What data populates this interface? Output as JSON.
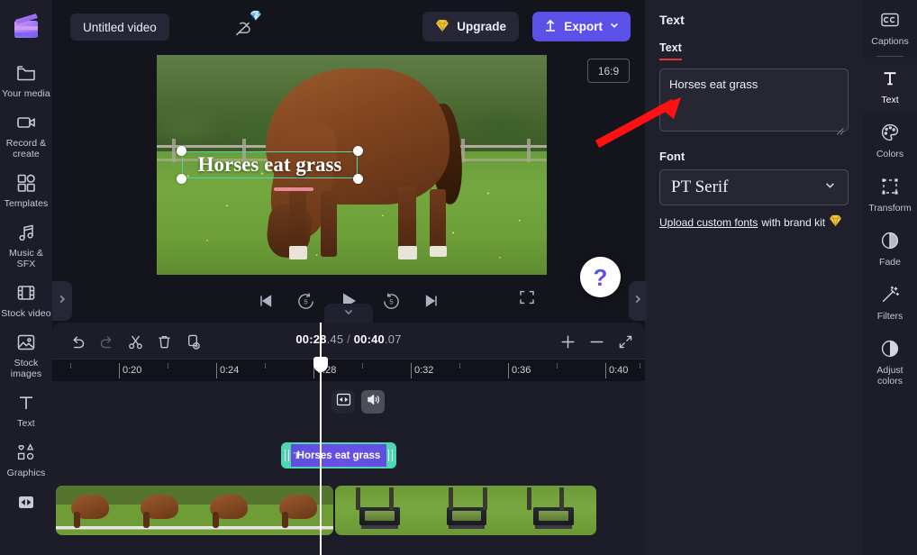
{
  "app": {
    "logo_icon": "clapperboard-logo",
    "window_title": "Untitled video"
  },
  "left_sidebar": {
    "items": [
      {
        "label": "Your media",
        "icon": "folder-icon"
      },
      {
        "label": "Record & create",
        "icon": "video-camera-icon"
      },
      {
        "label": "Templates",
        "icon": "templates-grid-icon"
      },
      {
        "label": "Music & SFX",
        "icon": "music-note-icon"
      },
      {
        "label": "Stock video",
        "icon": "film-strip-icon"
      },
      {
        "label": "Stock images",
        "icon": "image-icon"
      },
      {
        "label": "Text",
        "icon": "text-t-icon"
      },
      {
        "label": "Graphics",
        "icon": "shapes-icon"
      },
      {
        "label": "",
        "icon": "transitions-icon"
      }
    ],
    "collapse_icon": "chevron-right-icon"
  },
  "topbar": {
    "project_title": "Untitled video",
    "cloud_status_icon": "cloud-off-icon",
    "cloud_gem_icon": "gem-icon",
    "upgrade_label": "Upgrade",
    "upgrade_icon": "gem-icon",
    "export_label": "Export",
    "export_icon": "upload-arrow-icon",
    "export_chevron_icon": "chevron-down-icon",
    "export_color": "#5b51e8"
  },
  "preview": {
    "aspect_ratio": "16:9",
    "overlay_text": "Horses eat grass",
    "selection_color": "#4fd6b0",
    "underline_color": "#e98b92",
    "controls": [
      {
        "name": "skip-to-start",
        "icon": "skip-back-icon"
      },
      {
        "name": "rewind-5-seconds",
        "icon": "rewind-5-icon"
      },
      {
        "name": "play",
        "icon": "play-icon"
      },
      {
        "name": "forward-5-seconds",
        "icon": "forward-5-icon"
      },
      {
        "name": "skip-to-end",
        "icon": "skip-forward-icon"
      }
    ],
    "fullscreen_icon": "fullscreen-icon",
    "help_glyph": "?",
    "collapse_icon": "chevron-down-icon"
  },
  "timeline": {
    "tools": [
      {
        "name": "undo",
        "icon": "undo-arrow-icon",
        "disabled": false
      },
      {
        "name": "redo",
        "icon": "redo-arrow-icon",
        "disabled": true
      },
      {
        "name": "split",
        "icon": "scissors-icon",
        "disabled": false
      },
      {
        "name": "delete",
        "icon": "trash-icon",
        "disabled": false
      },
      {
        "name": "duplicate",
        "icon": "duplicate-plus-icon",
        "disabled": false
      }
    ],
    "current_time": "00:28",
    "current_time_ms": ".45",
    "time_separator": " / ",
    "total_time": "00:40",
    "total_time_ms": ".07",
    "zoom_in_icon": "plus-icon",
    "zoom_out_icon": "minus-icon",
    "fit_icon": "fit-timeline-icon",
    "ruler_labels": [
      "0:20",
      "0:24",
      "0:28",
      "0:32",
      "0:36",
      "0:40"
    ],
    "text_clip_label": "Horses eat grass",
    "text_clip_color": "#5b4fe0",
    "text_clip_border": "#4fd6b0",
    "badge_transition_icon": "transition-icon",
    "badge_audio_icon": "speaker-icon"
  },
  "properties_panel": {
    "title": "Text",
    "text_field_label": "Text",
    "text_field_value": "Horses eat grass",
    "font_label": "Font",
    "font_value": "PT Serif",
    "font_chevron_icon": "chevron-down-icon",
    "upload_link": "Upload custom fonts",
    "upload_suffix": "with brand kit",
    "upload_gem_icon": "gem-icon",
    "collapse_icon": "chevron-right-icon",
    "underline_accent": "#e0363c"
  },
  "right_rail": {
    "items": [
      {
        "label": "Captions",
        "icon": "closed-captions-icon",
        "active": false
      },
      {
        "label": "Text",
        "icon": "text-t-icon",
        "active": true
      },
      {
        "label": "Colors",
        "icon": "palette-icon",
        "active": false
      },
      {
        "label": "Transform",
        "icon": "transform-box-icon",
        "active": false
      },
      {
        "label": "Fade",
        "icon": "fade-circle-icon",
        "active": false
      },
      {
        "label": "Filters",
        "icon": "magic-wand-icon",
        "active": false
      },
      {
        "label": "Adjust colors",
        "icon": "contrast-circle-icon",
        "active": false
      }
    ]
  },
  "annotation": {
    "arrow_color": "#ff1111",
    "arrow_name": "red-pointer-arrow"
  }
}
